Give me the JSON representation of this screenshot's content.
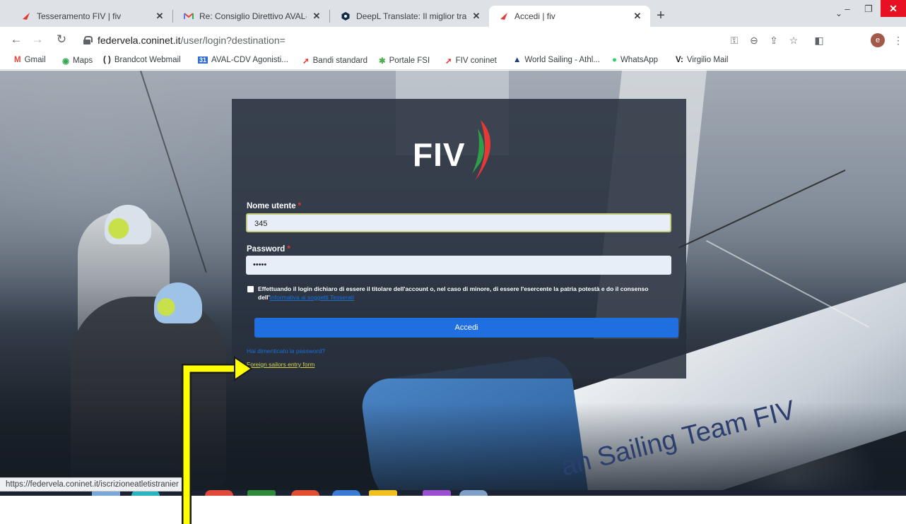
{
  "tabs": [
    {
      "title": "Tesseramento FIV | fiv",
      "active": false,
      "favicon": "fiv-logo-icon"
    },
    {
      "title": "Re: Consiglio Direttivo AVAL-CDV",
      "active": false,
      "favicon": "gmail-icon"
    },
    {
      "title": "DeepL Translate: Il miglior tradut",
      "active": false,
      "favicon": "deepl-icon"
    },
    {
      "title": "Accedi | fiv",
      "active": true,
      "favicon": "fiv-logo-icon"
    }
  ],
  "address": {
    "domain": "federvela.coninet.it",
    "path": "/user/login?destination="
  },
  "bookmarks": [
    {
      "label": "Gmail",
      "icon": "gmail-icon"
    },
    {
      "label": "Maps",
      "icon": "maps-icon"
    },
    {
      "label": "Brandcot Webmail",
      "icon": "brackets-icon"
    },
    {
      "label": "AVAL-CDV Agonisti...",
      "icon": "calendar-icon"
    },
    {
      "label": "Bandi standard",
      "icon": "fiv-logo-icon"
    },
    {
      "label": "Portale FSI",
      "icon": "fsi-icon"
    },
    {
      "label": "FIV coninet",
      "icon": "fiv-logo-icon"
    },
    {
      "label": "World Sailing - Athl...",
      "icon": "world-sailing-icon"
    },
    {
      "label": "WhatsApp",
      "icon": "whatsapp-icon"
    },
    {
      "label": "Virgilio Mail",
      "icon": "virgilio-icon"
    }
  ],
  "profile_initial": "e",
  "login": {
    "logo_text": "FIV",
    "username_label": "Nome utente",
    "username_value": "345",
    "password_label": "Password",
    "password_value": "•••••",
    "required_mark": "*",
    "consent_text": "Effettuando il login dichiaro di essere il titolare dell'account o, nel caso di minore, di essere l'esercente la patria potestà e do il consenso dell'",
    "consent_link": "Informativa ai soggetti Tesserati",
    "submit_label": "Accedi",
    "forgot_link": "Hai dimenticato la password?",
    "foreign_link": "Foreign sailors entry form"
  },
  "background": {
    "hull_text": "an Sailing Team FIV"
  },
  "status_url": "https://federvela.coninet.it/iscrizioneatletistranier",
  "colors": {
    "accent": "#1f6fe0",
    "panel": "#28303e",
    "annotation": "#ffff00",
    "close": "#e81123"
  }
}
